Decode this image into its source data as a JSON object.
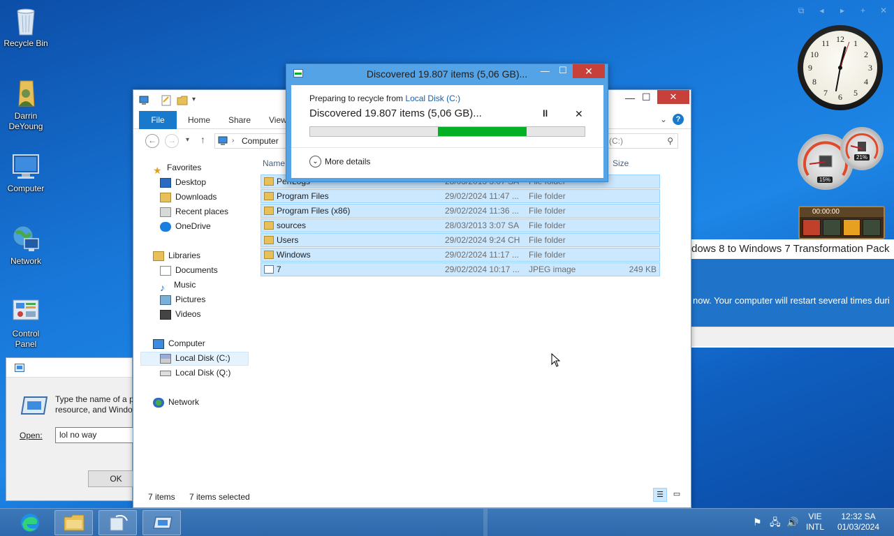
{
  "desktop": {
    "icons": [
      {
        "label": "Recycle Bin"
      },
      {
        "label": "Darrin DeYoung"
      },
      {
        "label": "Computer"
      },
      {
        "label": "Network"
      },
      {
        "label": "Control Panel"
      }
    ]
  },
  "gadgets": {
    "clock_numbers": [
      "12",
      "1",
      "2",
      "3",
      "4",
      "5",
      "6",
      "7",
      "8",
      "9",
      "10",
      "11"
    ],
    "meter_cpu": "15%",
    "meter_mem": "21%",
    "timer": "00:00:00"
  },
  "transformation_pack": {
    "title": "dows 8 to Windows 7 Transformation Pack",
    "message": "now. Your computer will restart several times duri"
  },
  "run_dialog": {
    "text_line1": "Type the name of a p",
    "text_line2": "resource, and Windo",
    "open_label": "Open:",
    "open_value": "lol no way",
    "ok_label": "OK"
  },
  "explorer": {
    "ribbon_tabs": {
      "file": "File",
      "home": "Home",
      "share": "Share",
      "view": "View"
    },
    "address": "Computer",
    "search_placeholder": "(C:)",
    "columns": {
      "name": "Name",
      "size": "Size"
    },
    "nav": {
      "favorites": "Favorites",
      "desktop": "Desktop",
      "downloads": "Downloads",
      "recent": "Recent places",
      "onedrive": "OneDrive",
      "libraries": "Libraries",
      "documents": "Documents",
      "music": "Music",
      "pictures": "Pictures",
      "videos": "Videos",
      "computer": "Computer",
      "local_c": "Local Disk (C:)",
      "local_q": "Local Disk (Q:)",
      "network": "Network"
    },
    "files": [
      {
        "name": "PerfLogs",
        "date": "28/03/2013 3:07 SA",
        "type": "File folder",
        "size": ""
      },
      {
        "name": "Program Files",
        "date": "29/02/2024 11:47 ...",
        "type": "File folder",
        "size": ""
      },
      {
        "name": "Program Files (x86)",
        "date": "29/02/2024 11:36 ...",
        "type": "File folder",
        "size": ""
      },
      {
        "name": "sources",
        "date": "28/03/2013 3:07 SA",
        "type": "File folder",
        "size": ""
      },
      {
        "name": "Users",
        "date": "29/02/2024 9:24 CH",
        "type": "File folder",
        "size": ""
      },
      {
        "name": "Windows",
        "date": "29/02/2024 11:17 ...",
        "type": "File folder",
        "size": ""
      },
      {
        "name": "7",
        "date": "29/02/2024 10:17 ...",
        "type": "JPEG image",
        "size": "249 KB"
      }
    ],
    "status_items": "7 items",
    "status_selected": "7 items selected"
  },
  "progress_dialog": {
    "title": "Discovered 19.807 items (5,06 GB)...",
    "preparing_prefix": "Preparing to recycle from ",
    "preparing_link": "Local Disk (C:)",
    "headline": "Discovered 19.807 items (5,06 GB)...",
    "more_details": "More details",
    "marquee_start": 0.466,
    "marquee_end": 0.79
  },
  "taskbar": {
    "lang_top": "VIE",
    "lang_bottom": "INTL",
    "time": "12:32 SA",
    "date": "01/03/2024"
  },
  "colors": {
    "accent": "#1979ca",
    "progress_green": "#06b025",
    "close_red": "#c7403a",
    "link": "#1a5ea8"
  }
}
